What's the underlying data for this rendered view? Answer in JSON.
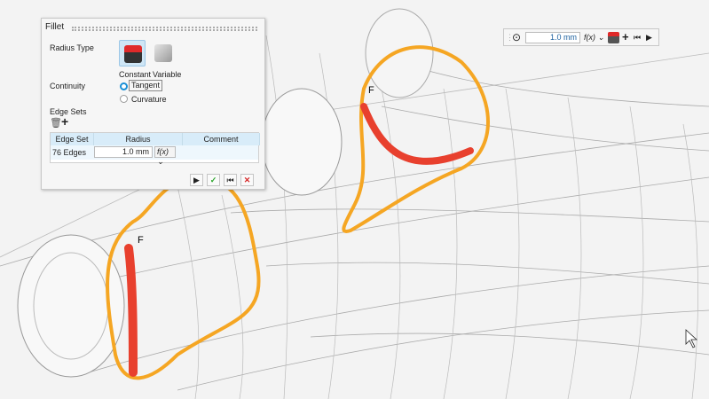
{
  "dialog": {
    "title": "Fillet",
    "radius_type_label": "Radius Type",
    "constant_label": "Constant",
    "variable_label": "Variable",
    "continuity_label": "Continuity",
    "tangent_label": "Tangent",
    "curvature_label": "Curvature",
    "continuity_selected": "Tangent",
    "edge_sets_label": "Edge Sets",
    "table": {
      "headers": [
        "Edge Set",
        "Radius",
        "Comment"
      ],
      "rows": [
        {
          "edge_set": "76 Edges",
          "radius": "1.0 mm",
          "fx": "f(x)",
          "comment": ""
        }
      ]
    },
    "actions": {
      "play": "▶",
      "ok": "✓",
      "skip": "⏮",
      "cancel": "✕"
    }
  },
  "toolbar": {
    "radius_value": "1.0 mm",
    "fx": "f(x)"
  },
  "viewport": {
    "fillet_markers": [
      "F",
      "F"
    ]
  },
  "colors": {
    "accent": "#1a8fd6",
    "fillet": "#e8402e",
    "fillet_edge": "#f5a623",
    "ok": "#2aa52a",
    "cancel": "#d62828"
  }
}
